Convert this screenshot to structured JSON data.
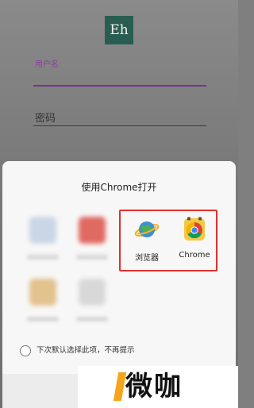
{
  "app": {
    "logo_text": "Eh",
    "username_label": "用户名",
    "password_placeholder": "密码"
  },
  "sheet": {
    "title": "使用Chrome打开",
    "apps": [
      {
        "label": "浏览器",
        "icon": "globe-planet-icon"
      },
      {
        "label": "Chrome",
        "icon": "chrome-icon"
      }
    ],
    "remember_label": "下次默认选择此项，不再提示",
    "remember_checked": false
  },
  "watermark": {
    "text": "微咖"
  },
  "colors": {
    "accent_purple": "#7a2f8d",
    "highlight_red": "#e0302b",
    "logo_green": "#2a5d52",
    "watermark_orange": "#f4a51c"
  }
}
